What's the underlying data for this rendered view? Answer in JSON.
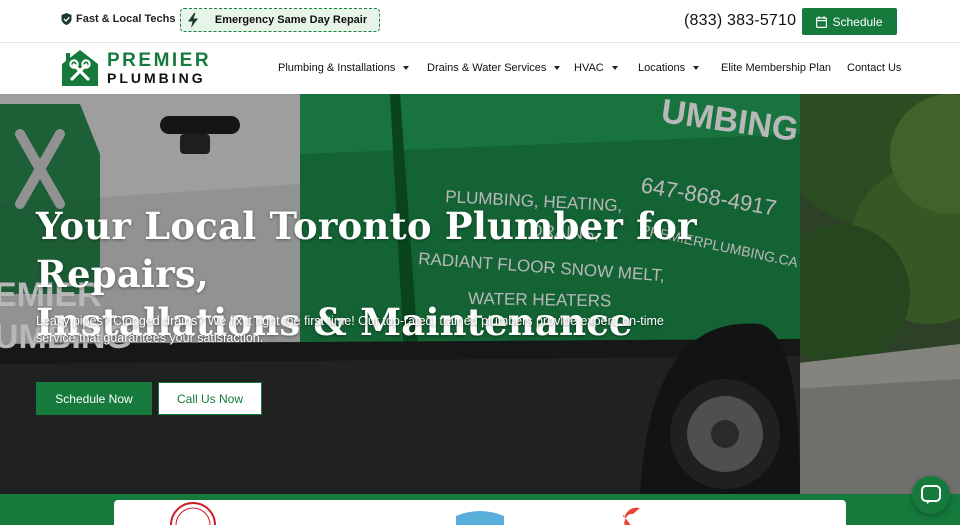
{
  "topbar": {
    "badge_text": "Fast & Local Techs",
    "emergency_text": "Emergency Same Day Repair",
    "phone": "(833) 383-5710",
    "schedule_label": "Schedule"
  },
  "logo": {
    "line1": "PREMIER",
    "line2": "PLUMBING"
  },
  "nav": {
    "items": [
      {
        "label": "Plumbing & Installations",
        "has_dropdown": true
      },
      {
        "label": "Drains & Water Services",
        "has_dropdown": true
      },
      {
        "label": "HVAC",
        "has_dropdown": true
      },
      {
        "label": "Locations",
        "has_dropdown": true
      },
      {
        "label": "Elite Membership Plan",
        "has_dropdown": false
      },
      {
        "label": "Contact Us",
        "has_dropdown": false
      }
    ]
  },
  "hero": {
    "title_line1": "Your Local Toronto Plumber for Repairs,",
    "title_line2": "Installations & Maintenance",
    "subtitle": "Leaky pipes? Clogged drains? We fix it right the first time! Our top-rated, trained plumbers provide expert, on-time service that guarantees your satisfaction.",
    "cta_primary": "Schedule Now",
    "cta_secondary": "Call Us Now",
    "van_text": {
      "brand_fragment": "UMBING",
      "services_line1": "PLUMBING, HEATING,",
      "services_line2": "DRAINS,",
      "services_line3": "RADIANT FLOOR SNOW MELT,",
      "services_line4": "WATER HEATERS",
      "phone": "647-868-4917",
      "url": "PREMIERPLUMBING.CA",
      "side_line1": "EMIER",
      "side_line2": "UMBING"
    }
  },
  "colors": {
    "brand_green": "#157a3c",
    "emergency_bg": "#e7f4ea"
  },
  "icons": {
    "shield": "shield-check-icon",
    "bolt": "lightning-bolt-icon",
    "calendar": "calendar-icon",
    "chat": "chat-bubble-icon"
  }
}
